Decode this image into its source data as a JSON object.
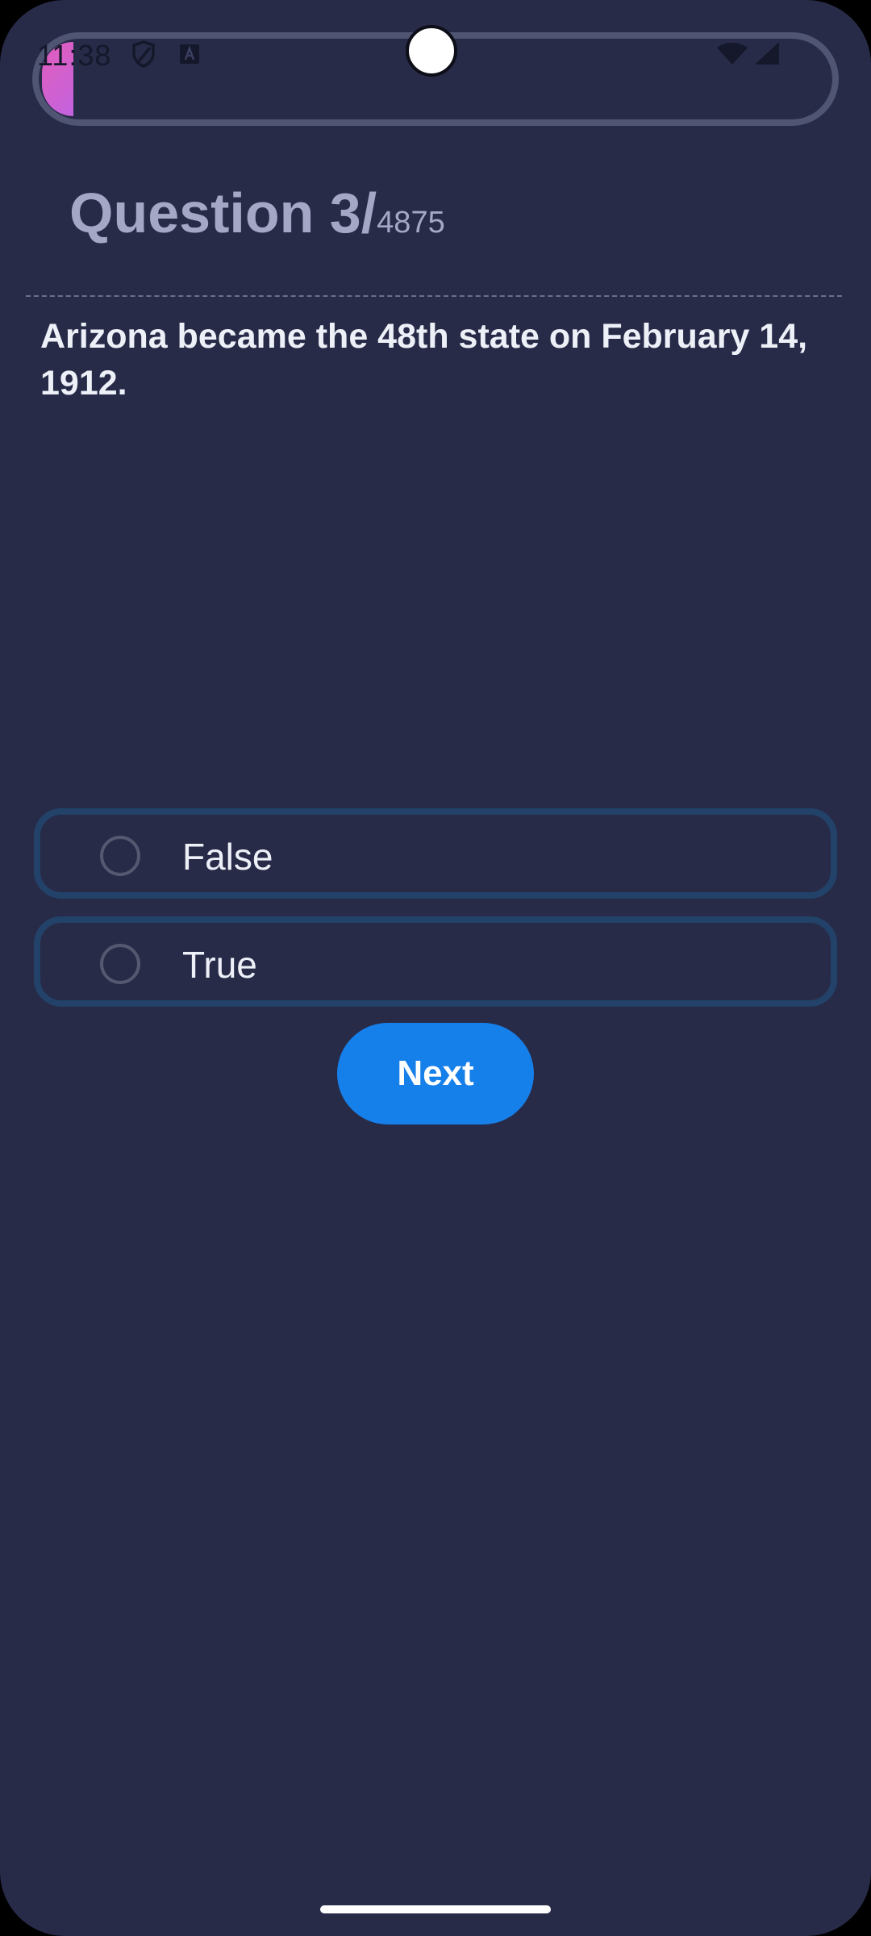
{
  "status_bar": {
    "time": "11:38",
    "icons": [
      "shield-icon",
      "font-a-icon",
      "wifi-icon",
      "cellular-signal-icon"
    ]
  },
  "progress": {
    "fraction": 0.04
  },
  "header": {
    "question_label": "Question 3/",
    "total": "4875"
  },
  "question": {
    "text": "Arizona became the 48th state on February 14, 1912."
  },
  "options": [
    {
      "label": "False",
      "selected": false
    },
    {
      "label": "True",
      "selected": false
    }
  ],
  "actions": {
    "next_label": "Next"
  },
  "colors": {
    "background": "#272b48",
    "accent": "#1680ea",
    "progress_gradient_start": "#e25dba",
    "progress_gradient_end": "#c363e0",
    "option_border": "#22426a"
  }
}
